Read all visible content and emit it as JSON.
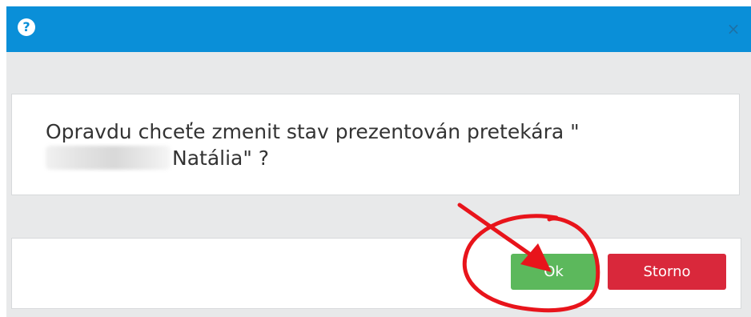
{
  "dialog": {
    "help_icon_glyph": "?",
    "close_icon_glyph": "×"
  },
  "message": {
    "line1": "Opravdu chceťe zmenit stav prezentován pretekára \"",
    "line2": "Natália\" ?"
  },
  "buttons": {
    "ok_label": "Ok",
    "storno_label": "Storno"
  },
  "colors": {
    "titlebar": "#0a8fd8",
    "ok": "#5cb85c",
    "storno": "#d9283b",
    "annotation": "#e8141b"
  }
}
